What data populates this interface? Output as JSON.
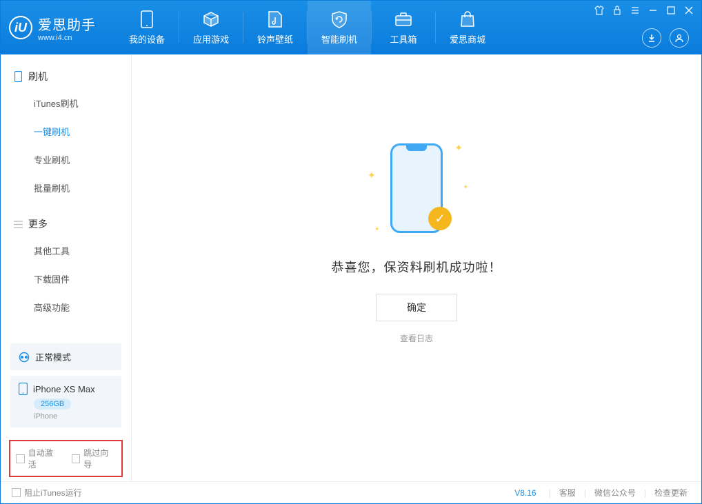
{
  "app": {
    "name": "爱思助手",
    "url": "www.i4.cn"
  },
  "nav": {
    "items": [
      {
        "label": "我的设备"
      },
      {
        "label": "应用游戏"
      },
      {
        "label": "铃声壁纸"
      },
      {
        "label": "智能刷机"
      },
      {
        "label": "工具箱"
      },
      {
        "label": "爱思商城"
      }
    ]
  },
  "sidebar": {
    "section1": {
      "title": "刷机",
      "items": [
        {
          "label": "iTunes刷机"
        },
        {
          "label": "一键刷机"
        },
        {
          "label": "专业刷机"
        },
        {
          "label": "批量刷机"
        }
      ]
    },
    "section2": {
      "title": "更多",
      "items": [
        {
          "label": "其他工具"
        },
        {
          "label": "下载固件"
        },
        {
          "label": "高级功能"
        }
      ]
    },
    "mode": "正常模式",
    "device": {
      "name": "iPhone XS Max",
      "storage": "256GB",
      "type": "iPhone"
    },
    "checkboxes": {
      "auto_activate": "自动激活",
      "skip_wizard": "跳过向导"
    }
  },
  "main": {
    "message": "恭喜您，保资料刷机成功啦！",
    "ok": "确定",
    "log": "查看日志"
  },
  "statusbar": {
    "block_itunes": "阻止iTunes运行",
    "version": "V8.16",
    "links": {
      "service": "客服",
      "wechat": "微信公众号",
      "update": "检查更新"
    }
  }
}
